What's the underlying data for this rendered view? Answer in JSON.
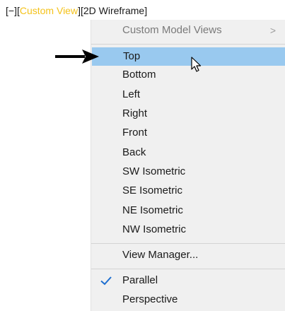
{
  "viewport_label": {
    "minus_control": "[−]",
    "view_control": "[Custom View]",
    "view_control_open": "[",
    "view_control_name": "Custom View",
    "view_control_close": "]",
    "visual_style_control": "[2D Wireframe]"
  },
  "menu": {
    "header": {
      "label": "Custom Model Views",
      "submenu_indicator": ">"
    },
    "views": [
      {
        "label": "Top",
        "highlighted": true
      },
      {
        "label": "Bottom"
      },
      {
        "label": "Left"
      },
      {
        "label": "Right"
      },
      {
        "label": "Front"
      },
      {
        "label": "Back"
      },
      {
        "label": "SW Isometric"
      },
      {
        "label": "SE Isometric"
      },
      {
        "label": "NE Isometric"
      },
      {
        "label": "NW Isometric"
      }
    ],
    "view_manager": {
      "label": "View Manager..."
    },
    "projection": [
      {
        "label": "Parallel",
        "checked": true
      },
      {
        "label": "Perspective",
        "checked": false
      }
    ]
  },
  "colors": {
    "highlight": "#99c9ef",
    "menu_background": "#f0f0f0",
    "accent_text": "#f4c21a",
    "checkmark": "#1c6dd0"
  },
  "icons": {
    "annotation_arrow": "black-arrow-right-icon",
    "cursor": "mouse-pointer-icon",
    "check": "checkmark-icon"
  }
}
